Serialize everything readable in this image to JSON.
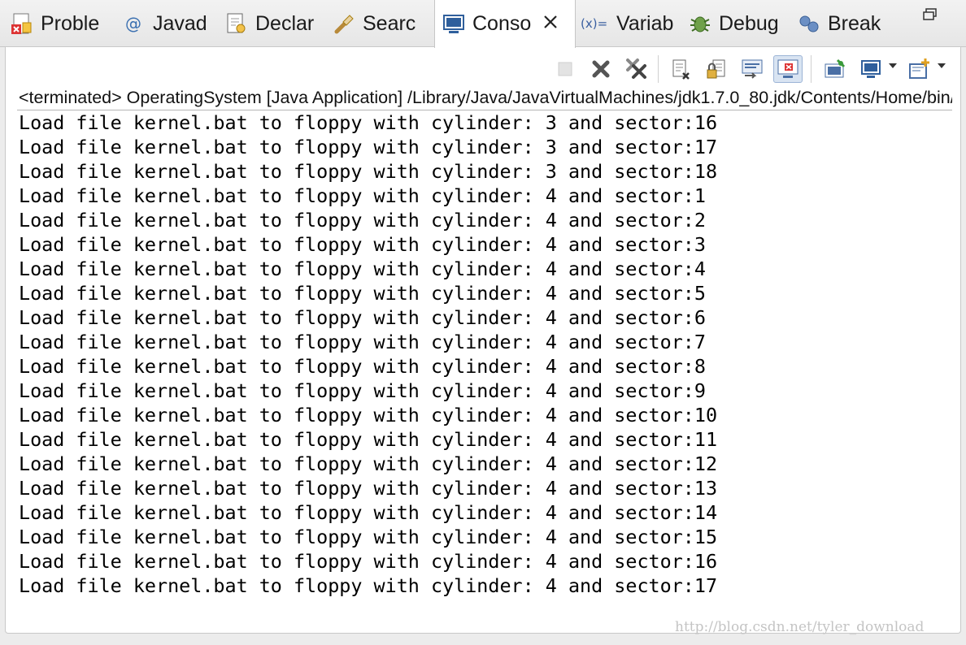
{
  "tabs": [
    {
      "label": "Proble",
      "icon": "problems-icon"
    },
    {
      "label": "Javad",
      "icon": "javadoc-icon"
    },
    {
      "label": "Declar",
      "icon": "declaration-icon"
    },
    {
      "label": "Searc",
      "icon": "search-icon"
    },
    {
      "label": "Conso",
      "icon": "console-icon",
      "active": true
    },
    {
      "label": "Variab",
      "icon": "variables-icon"
    },
    {
      "label": "Debug",
      "icon": "debug-icon"
    },
    {
      "label": "Break",
      "icon": "breakpoints-icon"
    }
  ],
  "console": {
    "header": "<terminated> OperatingSystem [Java Application] /Library/Java/JavaVirtualMachines/jdk1.7.0_80.jdk/Contents/Home/bin/java",
    "lines": [
      "Load file kernel.bat to floppy with cylinder: 3 and sector:16",
      "Load file kernel.bat to floppy with cylinder: 3 and sector:17",
      "Load file kernel.bat to floppy with cylinder: 3 and sector:18",
      "Load file kernel.bat to floppy with cylinder: 4 and sector:1",
      "Load file kernel.bat to floppy with cylinder: 4 and sector:2",
      "Load file kernel.bat to floppy with cylinder: 4 and sector:3",
      "Load file kernel.bat to floppy with cylinder: 4 and sector:4",
      "Load file kernel.bat to floppy with cylinder: 4 and sector:5",
      "Load file kernel.bat to floppy with cylinder: 4 and sector:6",
      "Load file kernel.bat to floppy with cylinder: 4 and sector:7",
      "Load file kernel.bat to floppy with cylinder: 4 and sector:8",
      "Load file kernel.bat to floppy with cylinder: 4 and sector:9",
      "Load file kernel.bat to floppy with cylinder: 4 and sector:10",
      "Load file kernel.bat to floppy with cylinder: 4 and sector:11",
      "Load file kernel.bat to floppy with cylinder: 4 and sector:12",
      "Load file kernel.bat to floppy with cylinder: 4 and sector:13",
      "Load file kernel.bat to floppy with cylinder: 4 and sector:14",
      "Load file kernel.bat to floppy with cylinder: 4 and sector:15",
      "Load file kernel.bat to floppy with cylinder: 4 and sector:16",
      "Load file kernel.bat to floppy with cylinder: 4 and sector:17"
    ]
  },
  "toolbar": {
    "buttons": [
      "terminate-icon",
      "remove-launch-icon",
      "remove-all-terminated-icon",
      "clear-console-icon",
      "scroll-lock-icon",
      "word-wrap-icon",
      "show-console-on-output-icon",
      "pin-console-icon",
      "display-selected-console-icon",
      "open-console-icon"
    ]
  },
  "watermark": "http://blog.csdn.net/tyler_download"
}
